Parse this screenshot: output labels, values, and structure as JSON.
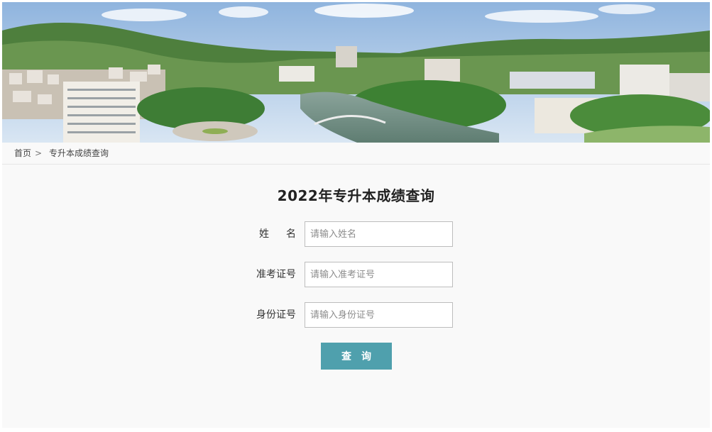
{
  "breadcrumb": {
    "home": "首页",
    "separator": ">",
    "current": "专升本成绩查询"
  },
  "form": {
    "title": "2022年专升本成绩查询",
    "fields": [
      {
        "label": "姓名",
        "value": "",
        "placeholder": "请输入姓名"
      },
      {
        "label": "准考证号",
        "value": "",
        "placeholder": "请输入准考证号"
      },
      {
        "label": "身份证号",
        "value": "",
        "placeholder": "请输入身份证号"
      }
    ],
    "submit_label": "查询"
  },
  "colors": {
    "button": "#4fa0ad",
    "page_background": "#f9f9f9",
    "input_border": "#bdbdbd"
  }
}
